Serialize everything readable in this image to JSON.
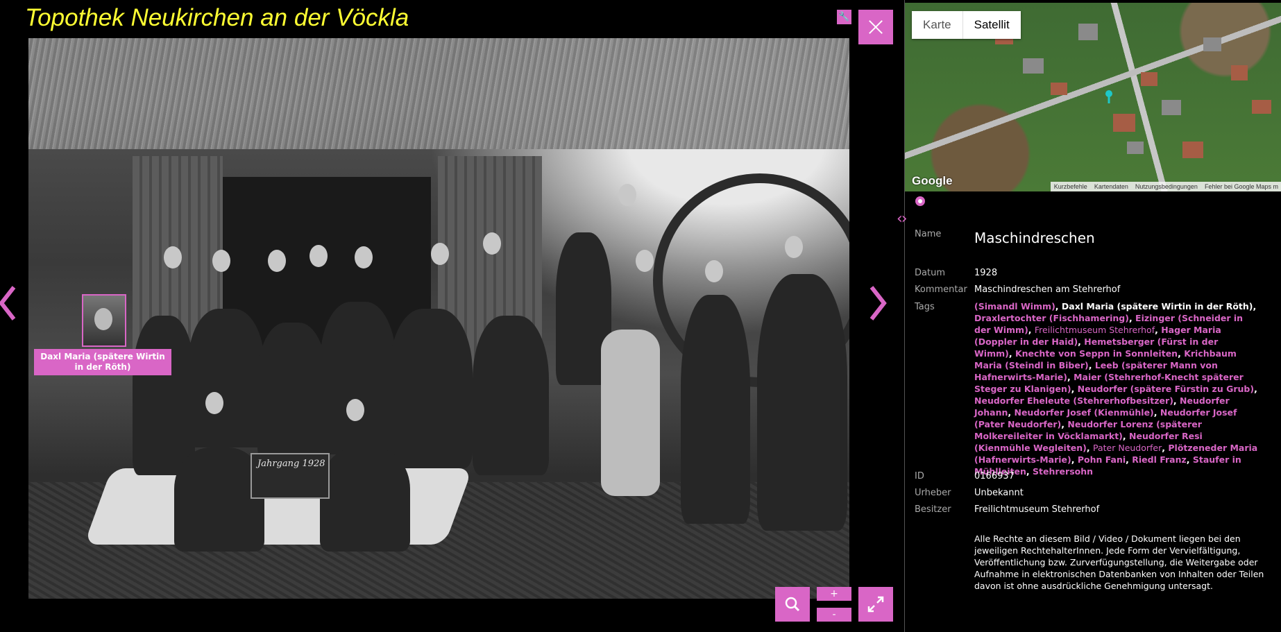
{
  "viewer": {
    "site_title": "Topothek Neukirchen an der Vöckla",
    "face_label": "Daxl Maria (spätere Wirtin in der Röth)",
    "plate_text": "Jahrgang 1928",
    "zoom_in_label": "+",
    "zoom_out_label": "-",
    "icons": [
      "wrench-icon",
      "close-icon",
      "search-icon",
      "expand-icon",
      "chevron-left-icon",
      "chevron-right-icon"
    ]
  },
  "map": {
    "tabs": [
      {
        "label": "Karte",
        "active": false
      },
      {
        "label": "Satellit",
        "active": true
      }
    ],
    "logo": "Google",
    "footer": [
      "Kurzbefehle",
      "Kartendaten",
      "Nutzungsbedingungen",
      "Fehler bei Google Maps m"
    ]
  },
  "details": {
    "name_label": "Name",
    "name": "Maschindreschen",
    "date_label": "Datum",
    "date": "1928",
    "comment_label": "Kommentar",
    "comment": "Maschindreschen am Stehrerhof",
    "tags_label": "Tags",
    "tags": [
      {
        "text": "(Simandl Wimm)",
        "style": "normal"
      },
      {
        "text": "Daxl Maria (spätere Wirtin in der Röth)",
        "style": "highlight"
      },
      {
        "text": "Draxlertochter (Fischhamering)",
        "style": "normal"
      },
      {
        "text": "Eizinger (Schneider in der Wimm)",
        "style": "normal"
      },
      {
        "text": "Freilichtmuseum Stehrerhof",
        "style": "light"
      },
      {
        "text": "Hager Maria (Doppler in der Haid)",
        "style": "normal"
      },
      {
        "text": "Hemetsberger (Fürst in der Wimm)",
        "style": "normal"
      },
      {
        "text": "Knechte von Seppn in Sonnleiten",
        "style": "normal"
      },
      {
        "text": "Krichbaum Maria (Steindl in Biber)",
        "style": "normal"
      },
      {
        "text": "Leeb (späterer Mann von Hafnerwirts-Marie)",
        "style": "normal"
      },
      {
        "text": "Maier (Stehrerhof-Knecht späterer Steger zu Klanigen)",
        "style": "normal"
      },
      {
        "text": "Neudorfer (spätere Fürstin zu Grub)",
        "style": "normal"
      },
      {
        "text": "Neudorfer Eheleute (Stehrerhofbesitzer)",
        "style": "normal"
      },
      {
        "text": "Neudorfer Johann",
        "style": "normal"
      },
      {
        "text": "Neudorfer Josef (Kienmühle)",
        "style": "normal"
      },
      {
        "text": "Neudorfer Josef (Pater Neudorfer)",
        "style": "normal"
      },
      {
        "text": "Neudorfer Lorenz (späterer Molkereileiter in Vöcklamarkt)",
        "style": "normal"
      },
      {
        "text": "Neudorfer Resi (Kienmühle Wegleiten)",
        "style": "normal"
      },
      {
        "text": "Pater Neudorfer",
        "style": "light"
      },
      {
        "text": "Plötzeneder Maria (Hafnerwirts-Marie)",
        "style": "normal"
      },
      {
        "text": "Pohn Fani",
        "style": "normal"
      },
      {
        "text": "Riedl Franz",
        "style": "normal"
      },
      {
        "text": "Staufer in Mühlleiten",
        "style": "normal"
      },
      {
        "text": "Stehrersohn",
        "style": "normal"
      }
    ],
    "id_label": "ID",
    "id": "0166937",
    "author_label": "Urheber",
    "author": "Unbekannt",
    "owner_label": "Besitzer",
    "owner": "Freilichtmuseum Stehrerhof",
    "rights": "Alle Rechte an diesem Bild / Video / Dokument liegen bei den jeweiligen RechtehalterInnen. Jede Form der Vervielfältigung, Veröffentlichung bzw. Zurverfügungstellung, die Weitergabe oder Aufnahme in elektronischen Datenbanken von Inhalten oder Teilen davon ist ohne ausdrückliche Genehmigung untersagt."
  },
  "colors": {
    "accent": "#d966c6",
    "title": "#ffff33",
    "background": "#000000"
  }
}
